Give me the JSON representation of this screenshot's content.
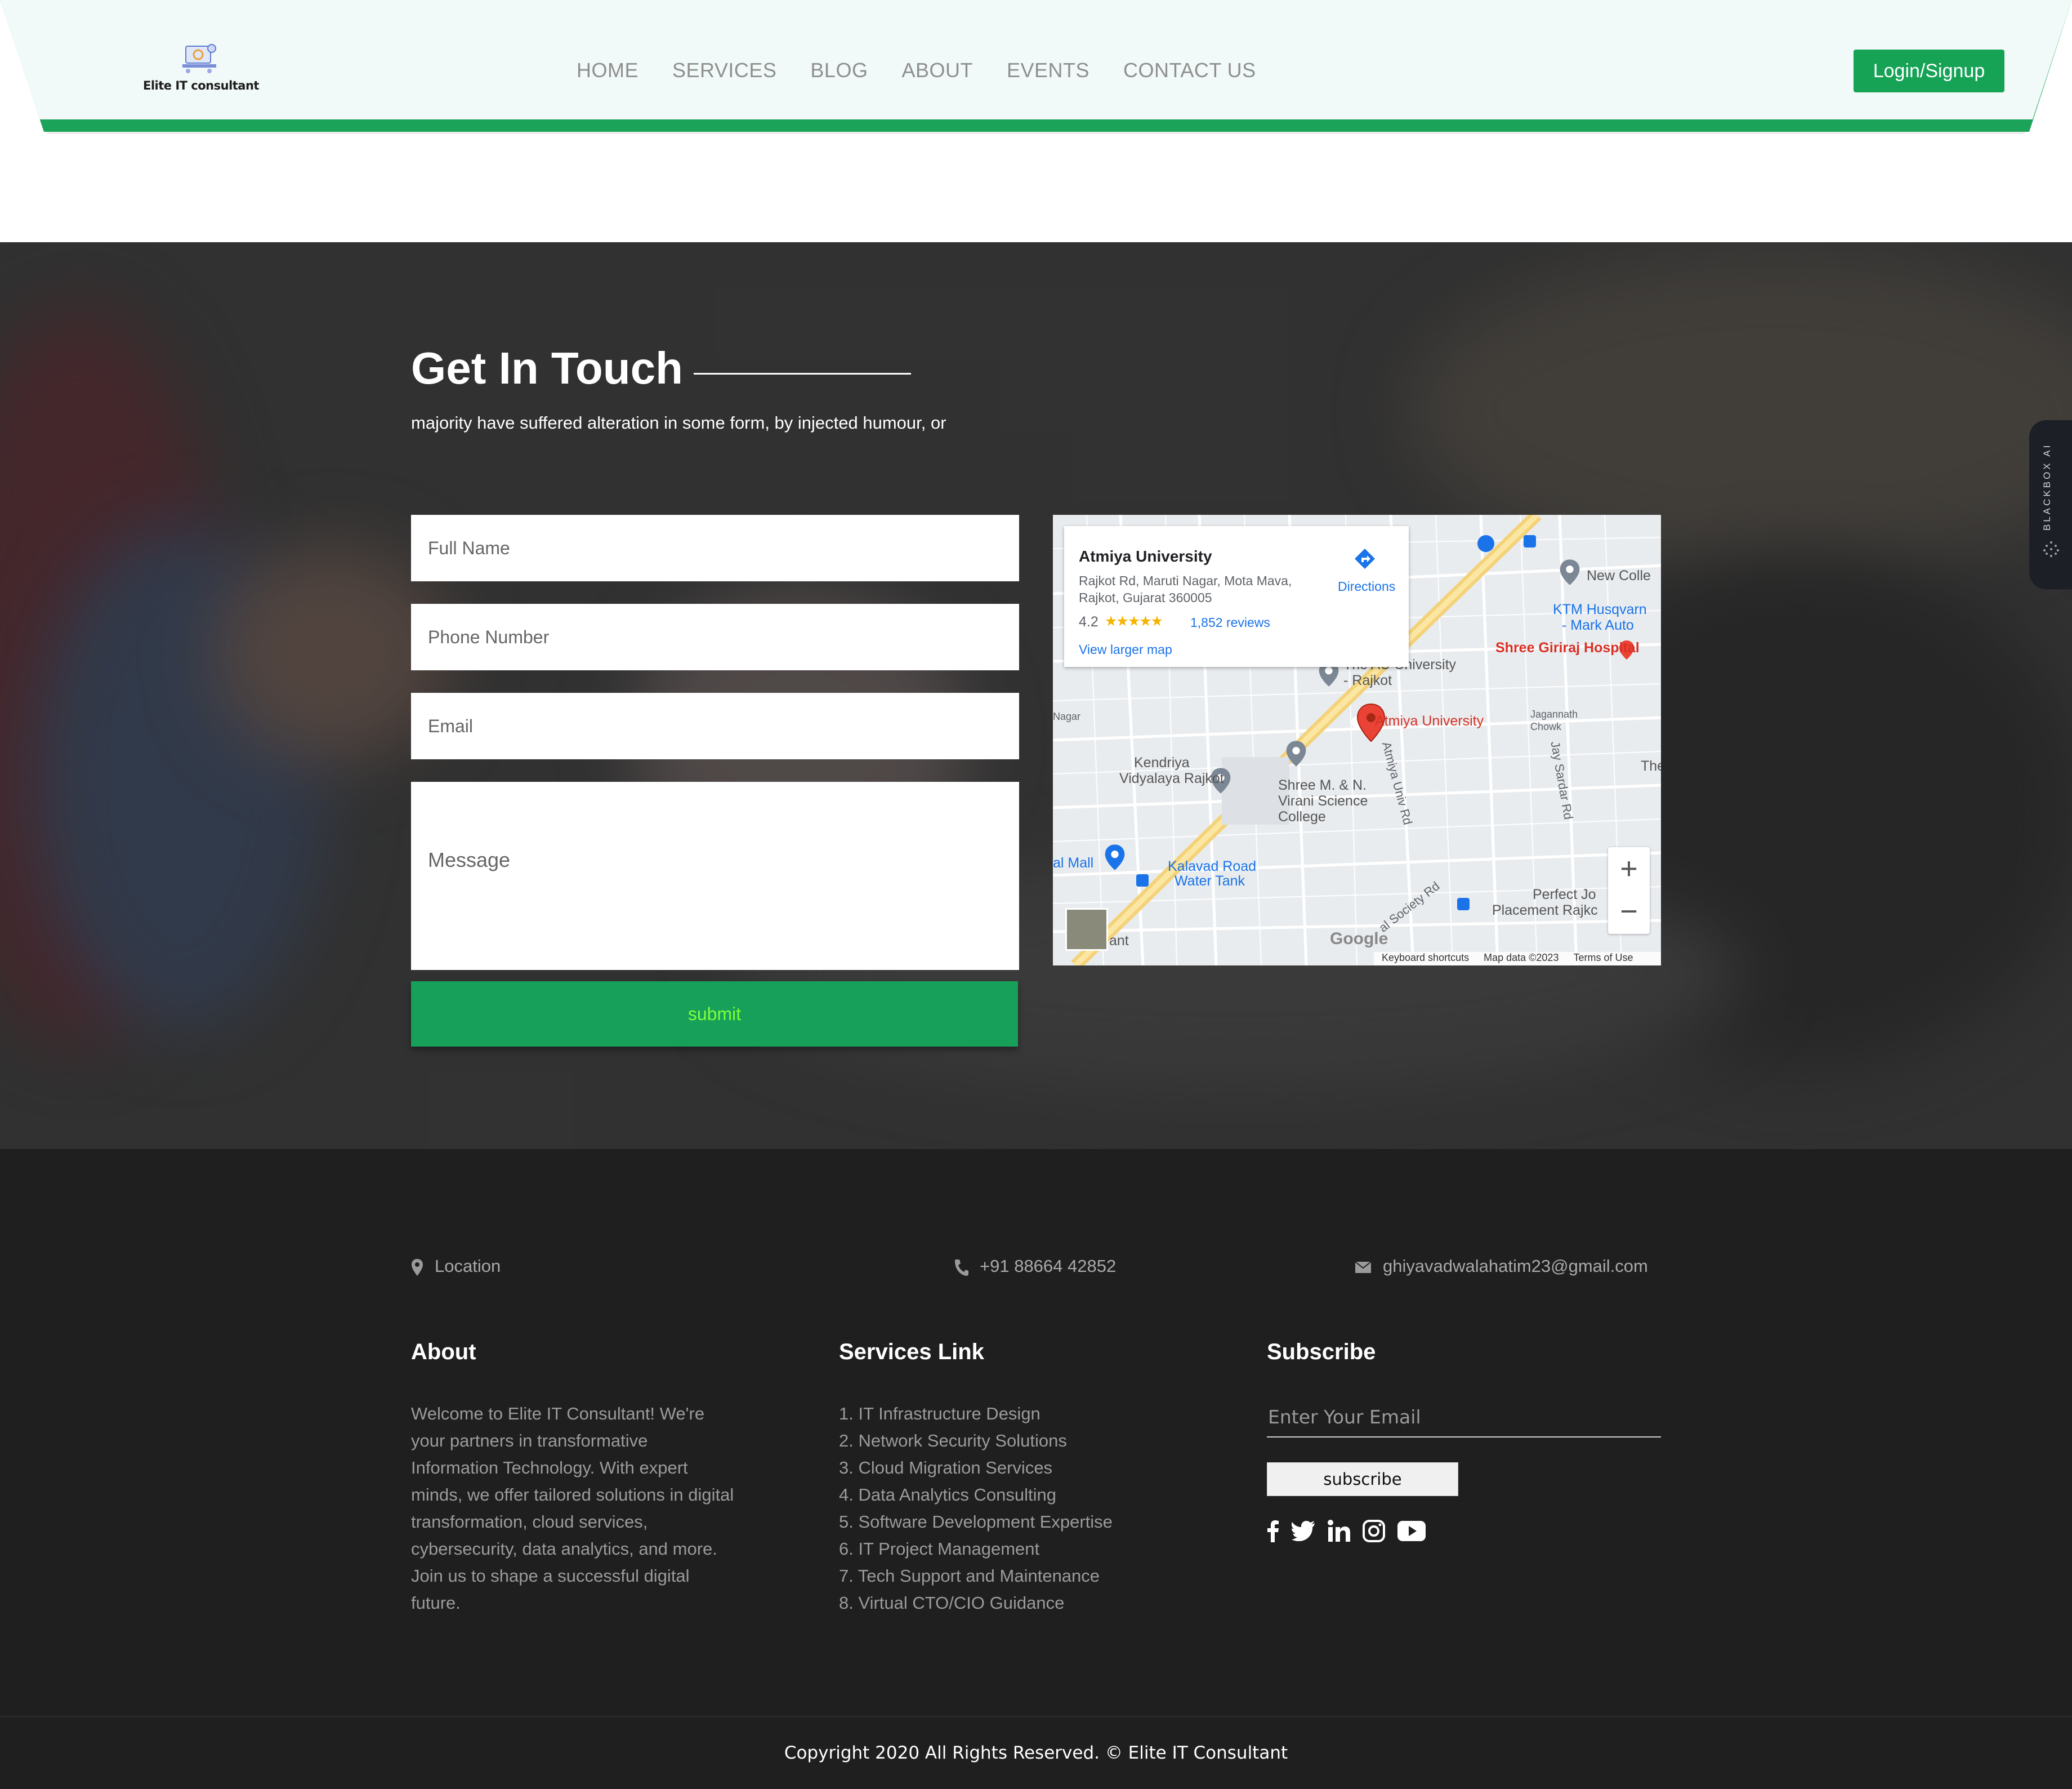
{
  "header": {
    "logo_text": "Elite IT consultant",
    "nav": [
      "HOME",
      "SERVICES",
      "BLOG",
      "ABOUT",
      "EVENTS",
      "CONTACT US"
    ],
    "login_label": "Login/Signup"
  },
  "contact": {
    "title": "Get In Touch",
    "subtitle": "majority have suffered alteration in some form, by injected humour, or",
    "full_name_placeholder": "Full Name",
    "phone_placeholder": "Phone Number",
    "email_placeholder": "Email",
    "message_placeholder": "Message",
    "submit_label": "submit"
  },
  "map": {
    "place_name": "Atmiya University",
    "address": "Rajkot Rd, Maruti Nagar, Mota Mava, Rajkot, Gujarat 360005",
    "rating": "4.2",
    "stars": "★★★★★",
    "reviews": "1,852 reviews",
    "larger_map": "View larger map",
    "directions": "Directions",
    "labels": {
      "new_college": "New Colle",
      "ktm": "KTM Husqvarn",
      "ktm2": "- Mark Auto",
      "giriraj": "Shree Giriraj Hospital",
      "au_university": "The AU University",
      "au_university2": "- Rajkot",
      "atmiya": "Atmiya University",
      "kendriya": "Kendriya",
      "kendriya2": "Vidyalaya Rajkot",
      "virani": "Shree M. & N.",
      "virani2": "Virani Science",
      "virani3": "College",
      "mall": "al Mall",
      "kalavad": "Kalavad Road",
      "kalavad2": "Water Tank",
      "jagannath": "Jagannath",
      "jagannath2": "Chowk",
      "perfect": "Perfect Jo",
      "perfect2": "Placement Rajkc",
      "atmiya_rd": "Atmiya Univ Rd",
      "jay_sardar": "Jay Sardar Rd",
      "society": "al Society Rd",
      "the": "The",
      "nagar": "Nagar",
      "ant": "ant",
      "google": "Google",
      "keyboard": "Keyboard shortcuts",
      "map_data": "Map data ©2023",
      "terms": "Terms of Use"
    },
    "zoom_in": "+",
    "zoom_out": "−"
  },
  "widget": {
    "label": "BLACKBOX AI"
  },
  "footer": {
    "location": "Location",
    "phone": "+91 88664 42852",
    "email": "ghiyavadwalahatim23@gmail.com",
    "about_head": "About",
    "about_text": "Welcome to Elite IT Consultant! We're your partners in transformative Information Technology. With expert minds, we offer tailored solutions in digital transformation, cloud services, cybersecurity, data analytics, and more. Join us to shape a successful digital future.",
    "services_head": "Services Link",
    "services": [
      "1. IT Infrastructure Design",
      "2. Network Security Solutions",
      "3. Cloud Migration Services",
      "4. Data Analytics Consulting",
      "5. Software Development Expertise",
      "6. IT Project Management",
      "7. Tech Support and Maintenance",
      "8. Virtual CTO/CIO Guidance"
    ],
    "subscribe_head": "Subscribe",
    "subscribe_placeholder": "Enter Your Email",
    "subscribe_label": "subscribe",
    "copyright": "Copyright 2020 All Rights Reserved. © Elite IT Consultant"
  }
}
